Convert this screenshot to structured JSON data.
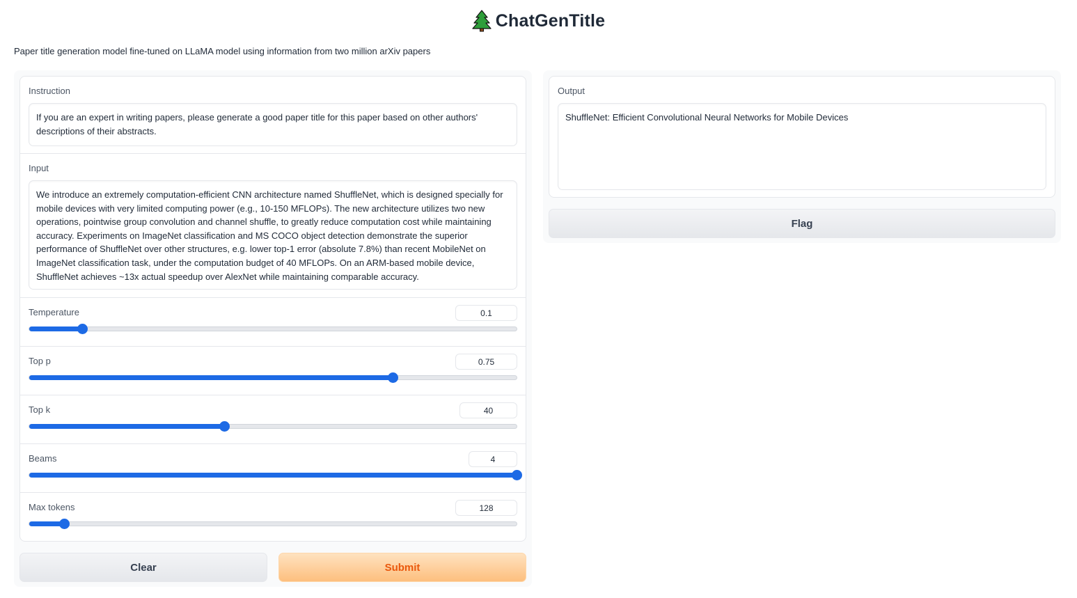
{
  "header": {
    "title": "ChatGenTitle",
    "icon": "evergreen-tree-icon",
    "subtitle": "Paper title generation model fine-tuned on LLaMA model using information from two million arXiv papers"
  },
  "inputs": {
    "instruction": {
      "label": "Instruction",
      "value": "If you are an expert in writing papers, please generate a good paper title for this paper based on other authors' descriptions of their abstracts."
    },
    "input": {
      "label": "Input",
      "value": "We introduce an extremely computation-efficient CNN architecture named ShuffleNet, which is designed specially for mobile devices with very limited computing power (e.g., 10-150 MFLOPs). The new architecture utilizes two new operations, pointwise group convolution and channel shuffle, to greatly reduce computation cost while maintaining accuracy. Experiments on ImageNet classification and MS COCO object detection demonstrate the superior performance of ShuffleNet over other structures, e.g. lower top-1 error (absolute 7.8%) than recent MobileNet on ImageNet classification task, under the computation budget of 40 MFLOPs. On an ARM-based mobile device, ShuffleNet achieves ~13x actual speedup over AlexNet while maintaining comparable accuracy."
    }
  },
  "sliders": [
    {
      "label": "Temperature",
      "value": "0.1",
      "fraction": 0.108
    },
    {
      "label": "Top p",
      "value": "0.75",
      "fraction": 0.746
    },
    {
      "label": "Top k",
      "value": "40",
      "fraction": 0.4
    },
    {
      "label": "Beams",
      "value": "4",
      "fraction": 1.0
    },
    {
      "label": "Max tokens",
      "value": "128",
      "fraction": 0.072
    }
  ],
  "buttons": {
    "clear": "Clear",
    "submit": "Submit",
    "flag": "Flag"
  },
  "output": {
    "label": "Output",
    "value": "ShuffleNet: Efficient Convolutional Neural Networks for Mobile Devices"
  },
  "colors": {
    "accent": "#1d6ae5",
    "primary_text": "#ea580c"
  }
}
